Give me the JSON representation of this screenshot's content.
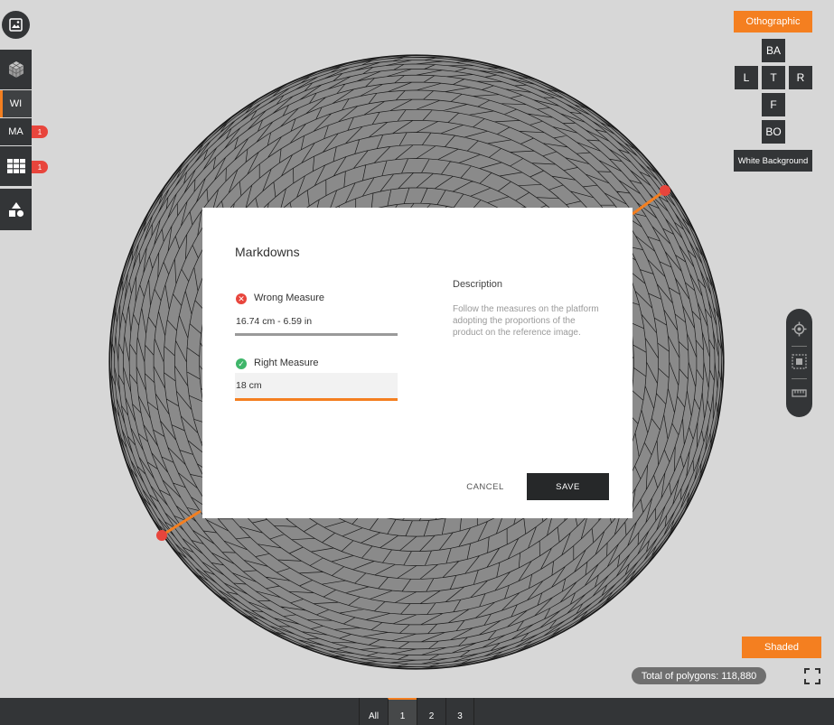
{
  "left_toolbar": {
    "wireframe_label": "WI",
    "materials_label": "MA",
    "materials_badge": "1",
    "grid_badge": "1"
  },
  "view_cube": {
    "projection_label": "Othographic",
    "back": "BA",
    "left": "L",
    "top": "T",
    "right": "R",
    "front": "F",
    "bottom": "BO",
    "background_label": "White Background"
  },
  "render_mode_label": "Shaded",
  "polygon_count": "Total of polygons: 118,880",
  "bottom_tabs": [
    "All",
    "1",
    "2",
    "3"
  ],
  "active_tab": "1",
  "modal": {
    "title": "Markdowns",
    "wrong_label": "Wrong Measure",
    "wrong_value": "16.74 cm  -  6.59 in",
    "right_label": "Right Measure",
    "right_value": "18 cm",
    "description_title": "Description",
    "description_text": "Follow the measures on the platform adopting the proportions of the product on the reference image.",
    "cancel_label": "CANCEL",
    "save_label": "SAVE"
  },
  "colors": {
    "accent": "#f47f20",
    "toolbar": "#333537",
    "mesh_fill": "#8a8a8a",
    "error": "#e8453c",
    "success": "#3fb66a"
  }
}
